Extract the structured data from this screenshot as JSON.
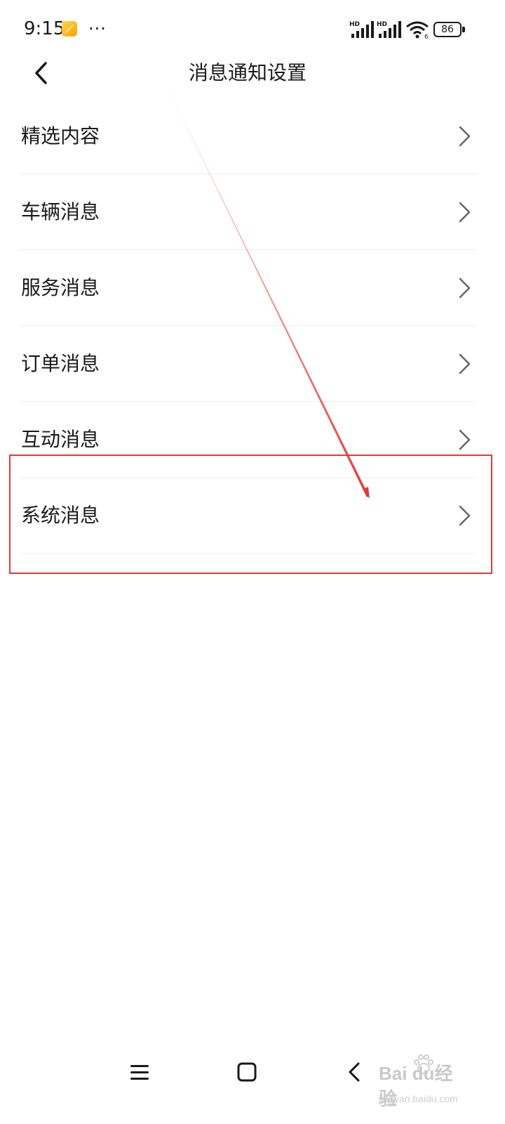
{
  "status_bar": {
    "time": "9:15",
    "more": "···",
    "battery_level": "86",
    "signal_label_1": "HD",
    "signal_label_2": "HD",
    "wifi_label": "6"
  },
  "header": {
    "title": "消息通知设置",
    "back_icon": "chevron-left-icon"
  },
  "settings": {
    "items": [
      {
        "label": "精选内容"
      },
      {
        "label": "车辆消息"
      },
      {
        "label": "服务消息"
      },
      {
        "label": "订单消息"
      },
      {
        "label": "互动消息"
      },
      {
        "label": "系统消息"
      }
    ]
  },
  "annotation": {
    "color": "#e53935",
    "highlighted_item": "系统消息"
  },
  "nav_bar": {
    "icons": [
      "menu-icon",
      "home-icon",
      "back-icon"
    ]
  },
  "watermark": {
    "logo": "Bai  du经验",
    "url": "jingyan.baidu.com"
  }
}
